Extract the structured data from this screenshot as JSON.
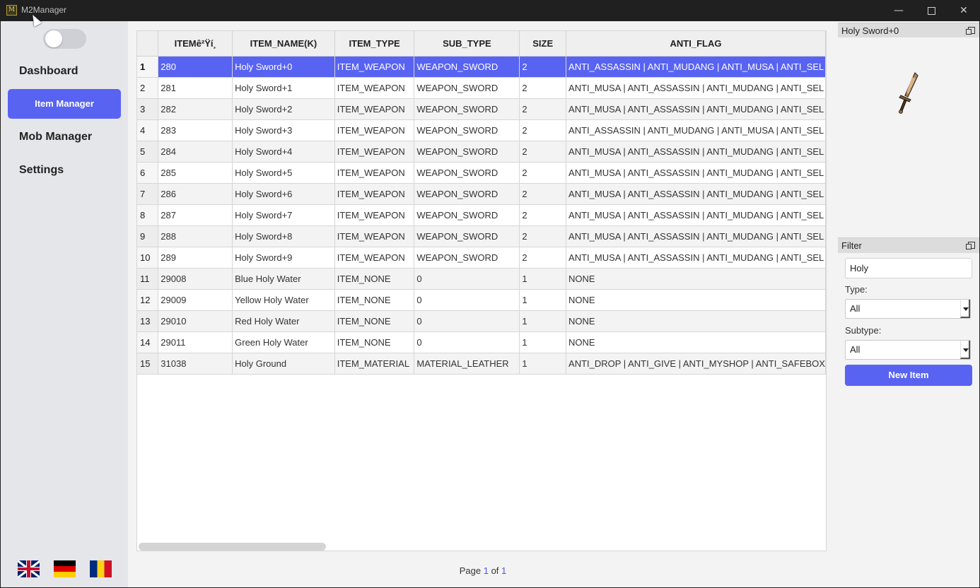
{
  "window": {
    "title": "M2Manager",
    "app_icon_glyph": "M",
    "min_glyph": "—",
    "close_glyph": "✕"
  },
  "sidebar": {
    "theme_toggle_on": false,
    "items": [
      {
        "label": "Dashboard",
        "active": false
      },
      {
        "label": "Item Manager",
        "active": true
      },
      {
        "label": "Mob Manager",
        "active": false
      },
      {
        "label": "Settings",
        "active": false
      }
    ],
    "languages": [
      "english-flag-icon",
      "german-flag-icon",
      "romanian-flag-icon"
    ]
  },
  "table": {
    "columns": [
      "ITEMê²Ÿí¸",
      "ITEM_NAME(K)",
      "ITEM_TYPE",
      "SUB_TYPE",
      "SIZE",
      "ANTI_FLAG"
    ],
    "selected_row": 1,
    "rows": [
      [
        "1",
        "280",
        "Holy Sword+0",
        "ITEM_WEAPON",
        "WEAPON_SWORD",
        "2",
        "ANTI_ASSASSIN | ANTI_MUDANG | ANTI_MUSA | ANTI_SEL"
      ],
      [
        "2",
        "281",
        "Holy Sword+1",
        "ITEM_WEAPON",
        "WEAPON_SWORD",
        "2",
        "ANTI_MUSA | ANTI_ASSASSIN | ANTI_MUDANG | ANTI_SEL"
      ],
      [
        "3",
        "282",
        "Holy Sword+2",
        "ITEM_WEAPON",
        "WEAPON_SWORD",
        "2",
        "ANTI_MUSA | ANTI_ASSASSIN | ANTI_MUDANG | ANTI_SEL"
      ],
      [
        "4",
        "283",
        "Holy Sword+3",
        "ITEM_WEAPON",
        "WEAPON_SWORD",
        "2",
        "ANTI_ASSASSIN | ANTI_MUDANG | ANTI_MUSA | ANTI_SEL"
      ],
      [
        "5",
        "284",
        "Holy Sword+4",
        "ITEM_WEAPON",
        "WEAPON_SWORD",
        "2",
        "ANTI_MUSA | ANTI_ASSASSIN | ANTI_MUDANG | ANTI_SEL"
      ],
      [
        "6",
        "285",
        "Holy Sword+5",
        "ITEM_WEAPON",
        "WEAPON_SWORD",
        "2",
        "ANTI_MUSA | ANTI_ASSASSIN | ANTI_MUDANG | ANTI_SEL"
      ],
      [
        "7",
        "286",
        "Holy Sword+6",
        "ITEM_WEAPON",
        "WEAPON_SWORD",
        "2",
        "ANTI_MUSA | ANTI_ASSASSIN | ANTI_MUDANG | ANTI_SEL"
      ],
      [
        "8",
        "287",
        "Holy Sword+7",
        "ITEM_WEAPON",
        "WEAPON_SWORD",
        "2",
        "ANTI_MUSA | ANTI_ASSASSIN | ANTI_MUDANG | ANTI_SEL"
      ],
      [
        "9",
        "288",
        "Holy Sword+8",
        "ITEM_WEAPON",
        "WEAPON_SWORD",
        "2",
        "ANTI_MUSA | ANTI_ASSASSIN | ANTI_MUDANG | ANTI_SEL"
      ],
      [
        "10",
        "289",
        "Holy Sword+9",
        "ITEM_WEAPON",
        "WEAPON_SWORD",
        "2",
        "ANTI_MUSA | ANTI_ASSASSIN | ANTI_MUDANG | ANTI_SEL"
      ],
      [
        "11",
        "29008",
        "Blue Holy Water",
        "ITEM_NONE",
        "0",
        "1",
        "NONE"
      ],
      [
        "12",
        "29009",
        "Yellow Holy Water",
        "ITEM_NONE",
        "0",
        "1",
        "NONE"
      ],
      [
        "13",
        "29010",
        "Red Holy Water",
        "ITEM_NONE",
        "0",
        "1",
        "NONE"
      ],
      [
        "14",
        "29011",
        "Green Holy Water",
        "ITEM_NONE",
        "0",
        "1",
        "NONE"
      ],
      [
        "15",
        "31038",
        "Holy Ground",
        "ITEM_MATERIAL",
        "MATERIAL_LEATHER",
        "1",
        "ANTI_DROP | ANTI_GIVE | ANTI_MYSHOP | ANTI_SAFEBOX"
      ]
    ]
  },
  "pager": {
    "prefix": "Page",
    "current": "1",
    "of": "of",
    "total": "1"
  },
  "preview": {
    "title": "Holy Sword+0",
    "icon": "sword-item-icon"
  },
  "filter": {
    "title": "Filter",
    "search_value": "Holy",
    "type_label": "Type:",
    "type_value": "All",
    "subtype_label": "Subtype:",
    "subtype_value": "All",
    "new_item_label": "New Item"
  },
  "colors": {
    "accent": "#5863f2",
    "titlebar": "#202020",
    "sidebar": "#e5e6ea"
  }
}
